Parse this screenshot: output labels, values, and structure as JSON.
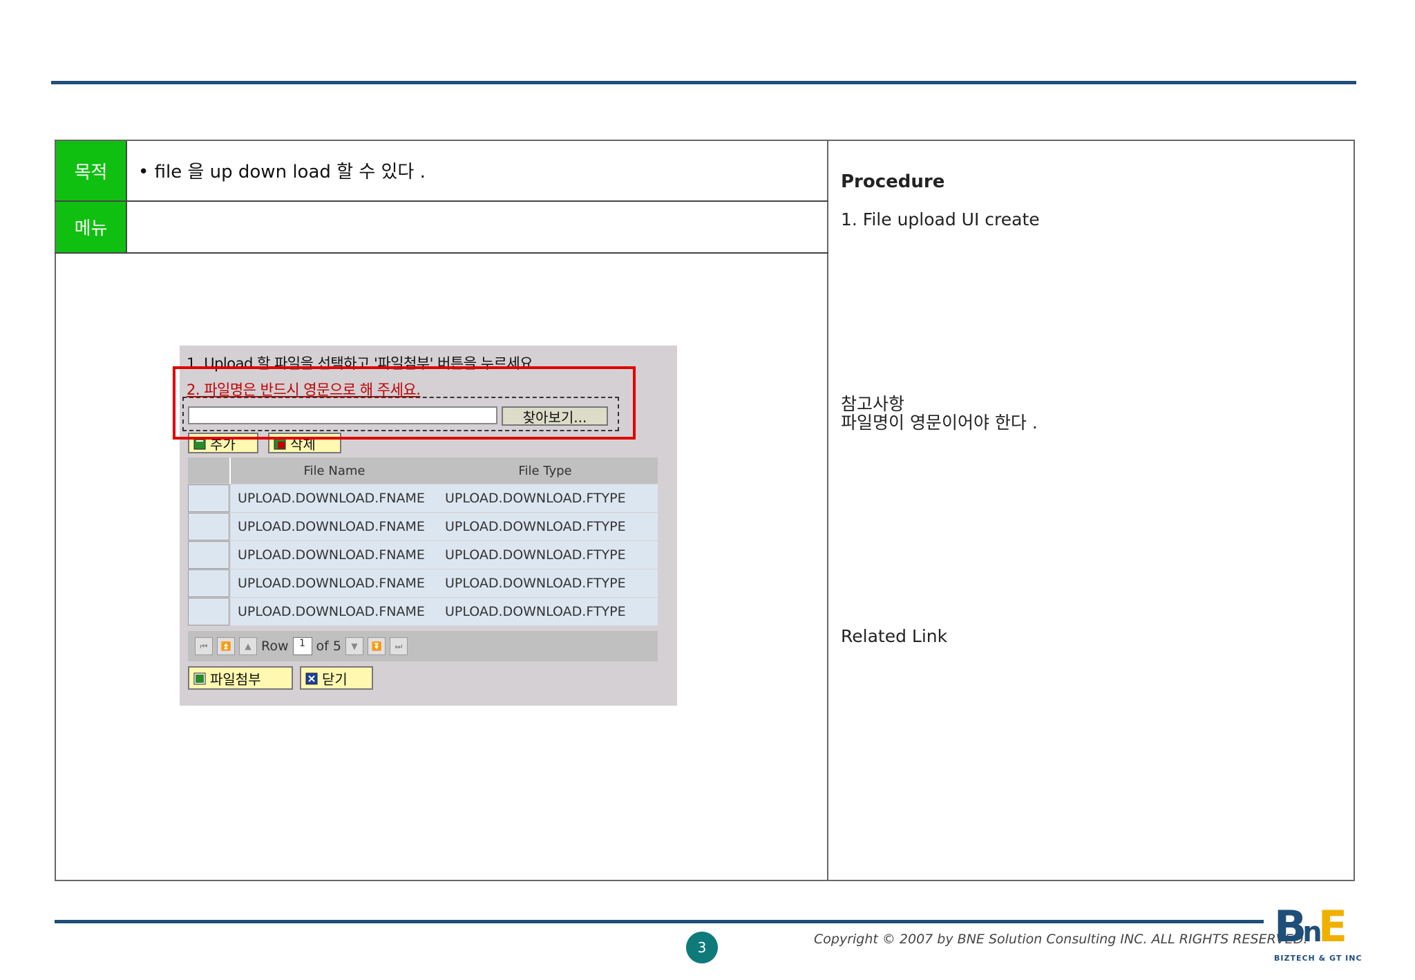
{
  "header": {},
  "table": {
    "purpose_label": "목적",
    "purpose_text": "• file 을  up down load  할 수 있다 .",
    "menu_label": "메뉴",
    "menu_text": ""
  },
  "screenshot": {
    "instruction_1": "1. Upload 할 파일을 선택하고 '파일첨부' 버튼을 누르세요.",
    "instruction_2": "2. 파일명은 반드시 영문으로 해 주세요.",
    "browse_label": "찾아보기...",
    "add_label": "추가",
    "delete_label": "삭제",
    "columns": [
      "File Name",
      "File Type"
    ],
    "rows": [
      [
        "UPLOAD.DOWNLOAD.FNAME",
        "UPLOAD.DOWNLOAD.FTYPE"
      ],
      [
        "UPLOAD.DOWNLOAD.FNAME",
        "UPLOAD.DOWNLOAD.FTYPE"
      ],
      [
        "UPLOAD.DOWNLOAD.FNAME",
        "UPLOAD.DOWNLOAD.FTYPE"
      ],
      [
        "UPLOAD.DOWNLOAD.FNAME",
        "UPLOAD.DOWNLOAD.FTYPE"
      ],
      [
        "UPLOAD.DOWNLOAD.FNAME",
        "UPLOAD.DOWNLOAD.FTYPE"
      ]
    ],
    "row_label": "Row",
    "row_value": "1",
    "of_label": "of 5",
    "attach_label": "파일첨부",
    "close_label": "닫기"
  },
  "right": {
    "procedure_title": "Procedure",
    "procedure_step": "1. File upload UI create",
    "note_title": "참고사항",
    "note_text": "파일명이 영문이어야 한다 .",
    "related_link": "Related Link"
  },
  "footer": {
    "page_number": "3",
    "copyright": "Copyright © 2007 by BNE Solution Consulting INC.   ALL RIGHTS RESERVED.",
    "logo_text": "BnE",
    "logo_sub": "BIZTECH & GT INC"
  },
  "colors": {
    "rule": "#1f4e79",
    "tag_green": "#10c010",
    "highlight_red": "#e00000",
    "page_badge": "#0f7a7a"
  }
}
